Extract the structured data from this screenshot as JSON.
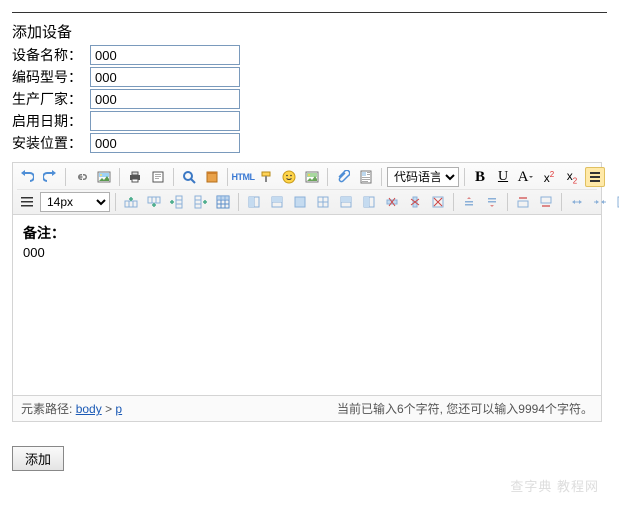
{
  "title": "添加设备",
  "fields": {
    "name": {
      "label": "设备名称：",
      "value": "000"
    },
    "model": {
      "label": "编码型号：",
      "value": "000"
    },
    "maker": {
      "label": "生产厂家：",
      "value": "000"
    },
    "date": {
      "label": "启用日期：",
      "value": ""
    },
    "place": {
      "label": "安装位置：",
      "value": "000"
    }
  },
  "editor": {
    "html_label": "HTML",
    "code_lang_label": "代码语言",
    "font_size_label": "14px",
    "bold": "B",
    "underline": "U",
    "font_a": "A",
    "sup": "2",
    "sub": "2",
    "x_char": "x",
    "remark_label": "备注：",
    "remark_content": "000",
    "path_label": "元素路径:",
    "path_body": "body",
    "path_sep": ">",
    "path_p": "p",
    "status_text": "当前已输入6个字符, 您还可以输入9994个字符。"
  },
  "submit": "添加",
  "watermark": "查字典 教程网"
}
